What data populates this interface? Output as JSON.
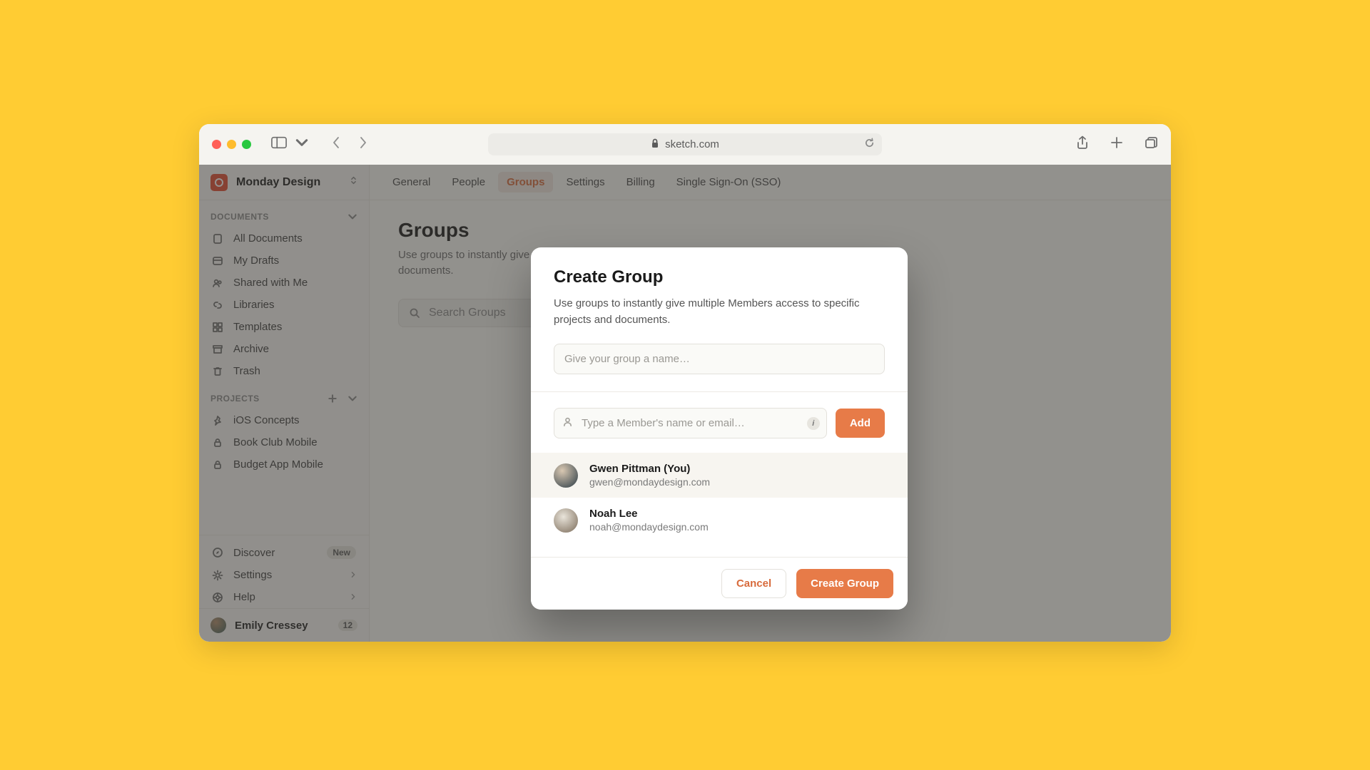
{
  "browser": {
    "url": "sketch.com"
  },
  "workspace": {
    "name": "Monday Design"
  },
  "sidebar": {
    "documents_header": "DOCUMENTS",
    "projects_header": "PROJECTS",
    "docs": [
      {
        "label": "All Documents"
      },
      {
        "label": "My Drafts"
      },
      {
        "label": "Shared with Me"
      },
      {
        "label": "Libraries"
      },
      {
        "label": "Templates"
      },
      {
        "label": "Archive"
      },
      {
        "label": "Trash"
      }
    ],
    "projects": [
      {
        "label": "iOS Concepts"
      },
      {
        "label": "Book Club Mobile"
      },
      {
        "label": "Budget App Mobile"
      }
    ],
    "footer": {
      "discover": "Discover",
      "discover_badge": "New",
      "settings": "Settings",
      "help": "Help"
    },
    "user": {
      "name": "Emily Cressey",
      "count": "12"
    }
  },
  "tabs": {
    "items": [
      "General",
      "People",
      "Groups",
      "Settings",
      "Billing",
      "Single Sign-On (SSO)"
    ],
    "active_index": 2
  },
  "page": {
    "title": "Groups",
    "subtitle": "Use groups to instantly give multiple Members access to specific projects and documents.",
    "search_placeholder": "Search Groups"
  },
  "modal": {
    "title": "Create Group",
    "desc": "Use groups to instantly give multiple Members access to specific projects and documents.",
    "name_placeholder": "Give your group a name…",
    "member_placeholder": "Type a Member's name or email…",
    "add_label": "Add",
    "members": [
      {
        "name": "Gwen Pittman (You)",
        "email": "gwen@mondaydesign.com"
      },
      {
        "name": "Noah Lee",
        "email": "noah@mondaydesign.com"
      }
    ],
    "cancel": "Cancel",
    "submit": "Create Group"
  }
}
